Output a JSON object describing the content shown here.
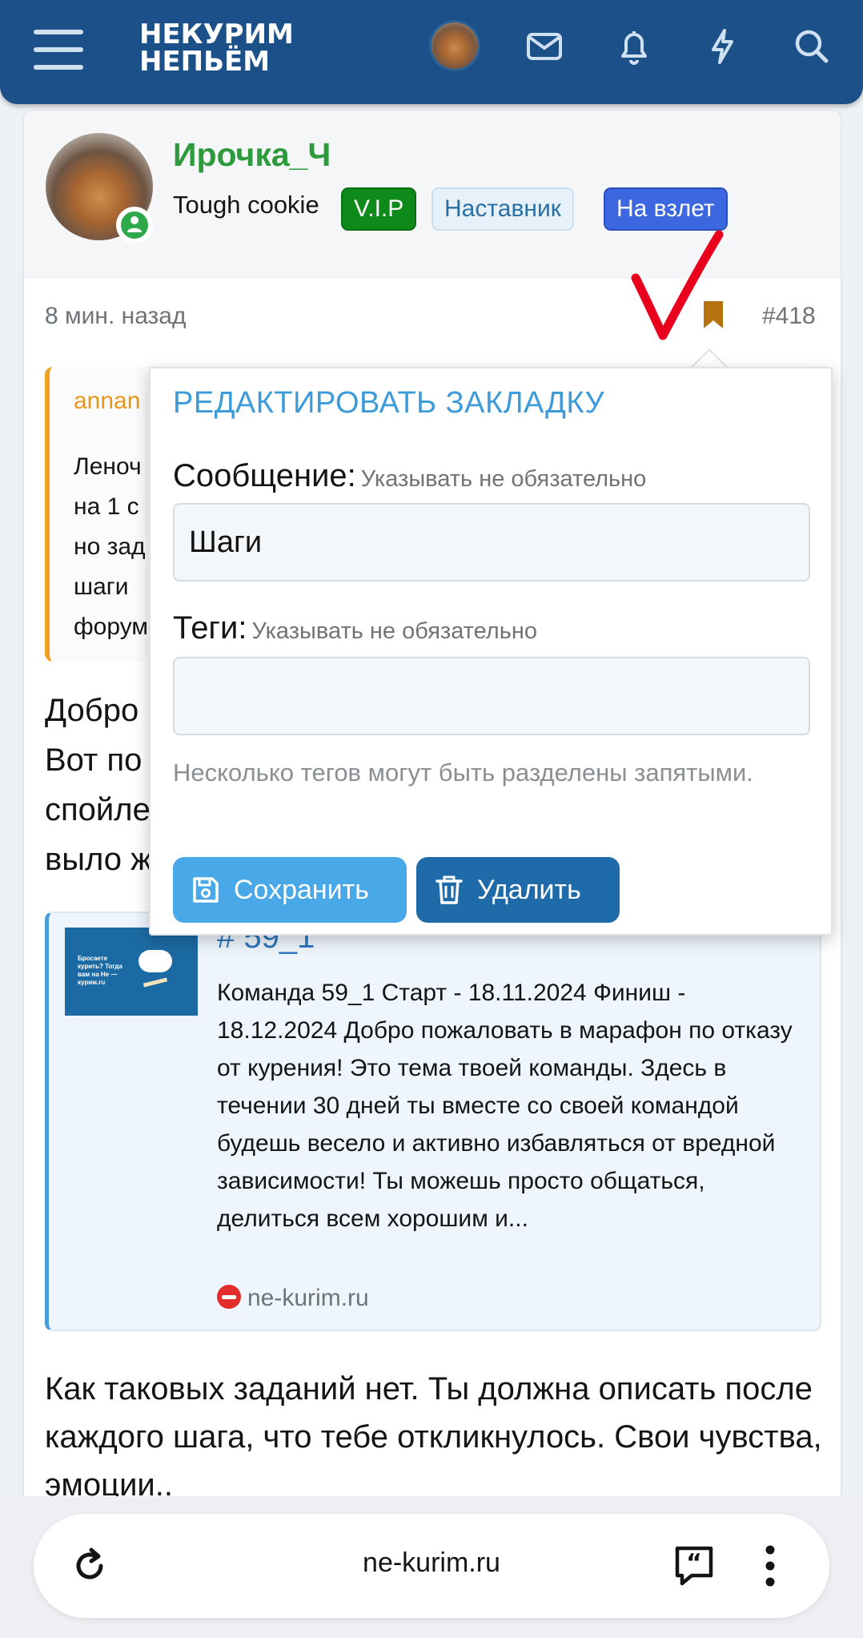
{
  "header": {
    "logo_line1": "НЕКУРИМ",
    "logo_line2": "НЕПЬЁМ",
    "icons": [
      "menu-icon",
      "avatar",
      "mail-icon",
      "bell-icon",
      "lightning-icon",
      "search-icon"
    ]
  },
  "post": {
    "username": "Ирочка_Ч",
    "user_title": "Tough cookie",
    "badges": [
      "V.I.P",
      "Наставник",
      "На взлет"
    ],
    "time": "8 мин. назад",
    "number": "#418",
    "quote_author": "annan",
    "quote_lines": [
      "Леноч",
      "на 1 с",
      "но зад",
      "шаги",
      "форум"
    ],
    "body_lines": [
      "Добро",
      "Вот по",
      "спойле",
      "выло ж"
    ],
    "unfurl": {
      "title": "# 59_1",
      "text": "Команда 59_1 Старт - 18.11.2024 Финиш - 18.12.2024 Добро пожаловать в марафон по отказу от курения! Это тема твоей команды. Здесь в течении 30 дней ты вместе со своей командой будешь весело и активно избавляться от вредной зависимости! Ты можешь просто общаться, делиться всем хорошим и...",
      "source": "ne-kurim.ru",
      "thumb_text": "Бросаете курить? Тогда вам на Не — курим.ru"
    },
    "bottom_text": "Как таковых заданий нет. Ты должна описать после каждого шага, что тебе откликнулось. Свои чувства, эмоции.."
  },
  "popup": {
    "title": "РЕДАКТИРОВАТЬ ЗАКЛАДКУ",
    "message_label": "Сообщение:",
    "message_hint": "Указывать не обязательно",
    "message_value": "Шаги",
    "tags_label": "Теги:",
    "tags_hint": "Указывать не обязательно",
    "tags_value": "",
    "help_text": "Несколько тегов могут быть разделены запятыми.",
    "save_label": "Сохранить",
    "delete_label": "Удалить"
  },
  "browser": {
    "url": "ne-kurim.ru"
  },
  "colors": {
    "header_bg": "#1c5088",
    "username": "#2d9a3c",
    "vip_badge": "#0d8a1a",
    "takeoff_badge": "#3c67e0",
    "popup_title": "#3c9bd8",
    "save_button": "#48a8e8",
    "delete_button": "#1f6aa9",
    "bookmark": "#b5720e",
    "annotation_check": "#e8001c"
  }
}
